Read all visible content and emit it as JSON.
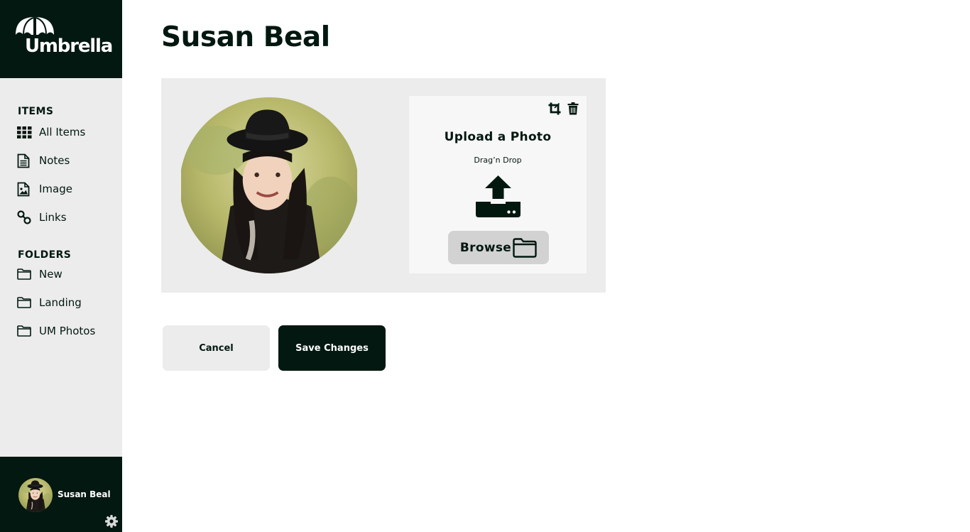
{
  "app": {
    "logo_text": "Umbrella"
  },
  "sidebar": {
    "items_heading": "ITEMS",
    "items": [
      {
        "label": "All Items",
        "icon": "grid-icon"
      },
      {
        "label": "Notes",
        "icon": "document-icon"
      },
      {
        "label": "Image",
        "icon": "image-icon"
      },
      {
        "label": "Links",
        "icon": "link-icon"
      }
    ],
    "folders_heading": "FOLDERS",
    "folders": [
      {
        "label": "New",
        "icon": "folder-icon"
      },
      {
        "label": "Landing",
        "icon": "folder-icon"
      },
      {
        "label": "UM Photos",
        "icon": "folder-icon"
      }
    ],
    "user": {
      "name": "Susan Beal"
    }
  },
  "main": {
    "title": "Susan Beal",
    "upload": {
      "title": "Upload a Photo",
      "subtitle": "Drag’n Drop",
      "browse_label": "Browse"
    },
    "actions": {
      "cancel_label": "Cancel",
      "save_label": "Save Changes"
    }
  },
  "colors": {
    "dark": "#031810",
    "panel": "#ececec",
    "button_gray": "#d2d2d2"
  }
}
